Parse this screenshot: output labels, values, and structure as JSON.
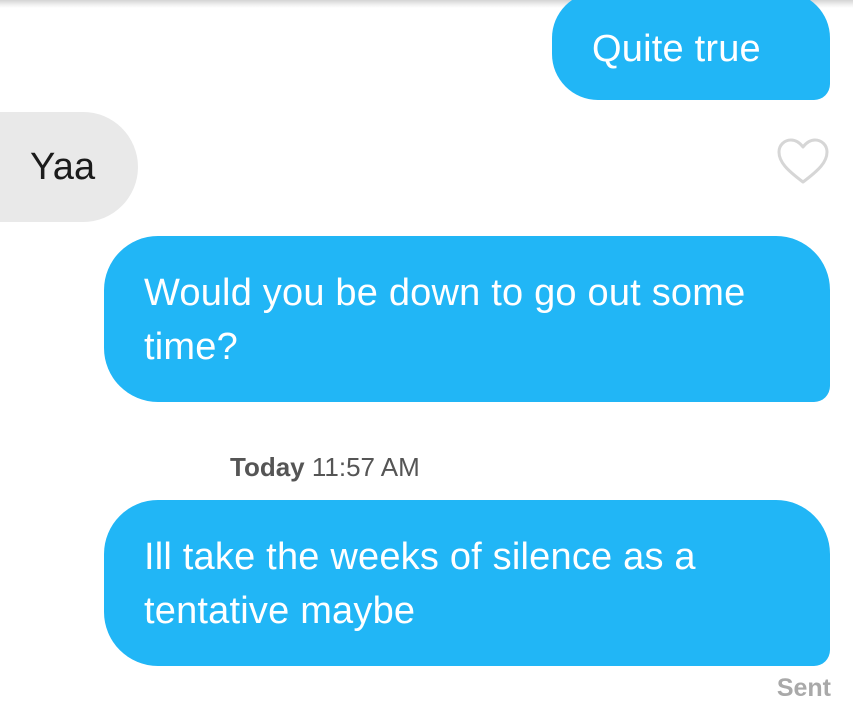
{
  "messages": [
    {
      "direction": "sent",
      "text": "Quite true"
    },
    {
      "direction": "received",
      "text": "Yaa",
      "like_icon": "heart-outline-icon"
    },
    {
      "direction": "sent",
      "text": "Would you be down to go out some time?"
    },
    {
      "direction": "sent",
      "text": "Ill take the weeks of silence as a tentative maybe"
    }
  ],
  "timestamp": {
    "day": "Today",
    "time": "11:57 AM"
  },
  "status": "Sent",
  "colors": {
    "sent_bubble": "#21b6f6",
    "received_bubble": "#e9e9e9",
    "heart_outline": "#d6d6d6",
    "status_text": "#a9a9a9"
  }
}
